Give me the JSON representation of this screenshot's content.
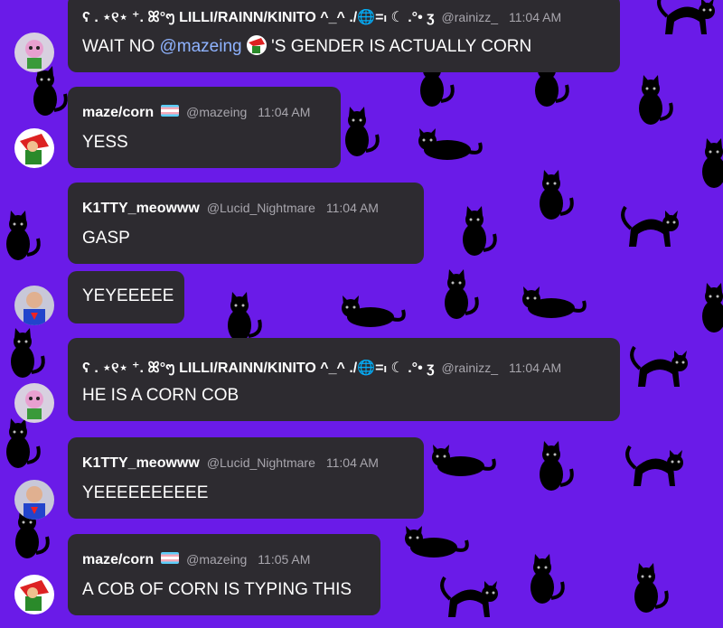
{
  "messages": [
    {
      "username": "ʕ . ⋆୧⋆ ⁺. ꕤ°ᪧ LILLI/RAINN/KINITO ^_^ ./🌐=ₗ ☾ .°• ʒ",
      "handle": "@rainizz_",
      "time": "11:04 AM",
      "text_before": "WAIT NO ",
      "mention": "@mazeing",
      "text_after": " 'S GENDER IS ACTUALLY CORN"
    },
    {
      "username": "maze/corn",
      "handle": "@mazeing",
      "time": "11:04 AM",
      "text": "YESS"
    },
    {
      "username": "K1TTY_meowww",
      "handle": "@Lucid_Nightmare",
      "time": "11:04 AM",
      "text": "GASP"
    },
    {
      "text": "YEYEEEEE"
    },
    {
      "username": "ʕ . ⋆୧⋆ ⁺. ꕤ°ᪧ LILLI/RAINN/KINITO ^_^ ./🌐=ₗ ☾ .°• ʒ",
      "handle": "@rainizz_",
      "time": "11:04 AM",
      "text": "HE IS A CORN COB"
    },
    {
      "username": "K1TTY_meowww",
      "handle": "@Lucid_Nightmare",
      "time": "11:04 AM",
      "text": "YEEEEEEEEEE"
    },
    {
      "username": "maze/corn",
      "handle": "@mazeing",
      "time": "11:05 AM",
      "text": "A COB OF CORN IS TYPING THIS"
    }
  ],
  "theme": {
    "background": "#6a1be8",
    "bubble": "#2d2b30",
    "mention": "#8fb3ff",
    "muted": "#a8a6ad"
  },
  "icons": {
    "wallpaper": "black-cat-pattern",
    "flag": "transgender-flag-icon"
  }
}
